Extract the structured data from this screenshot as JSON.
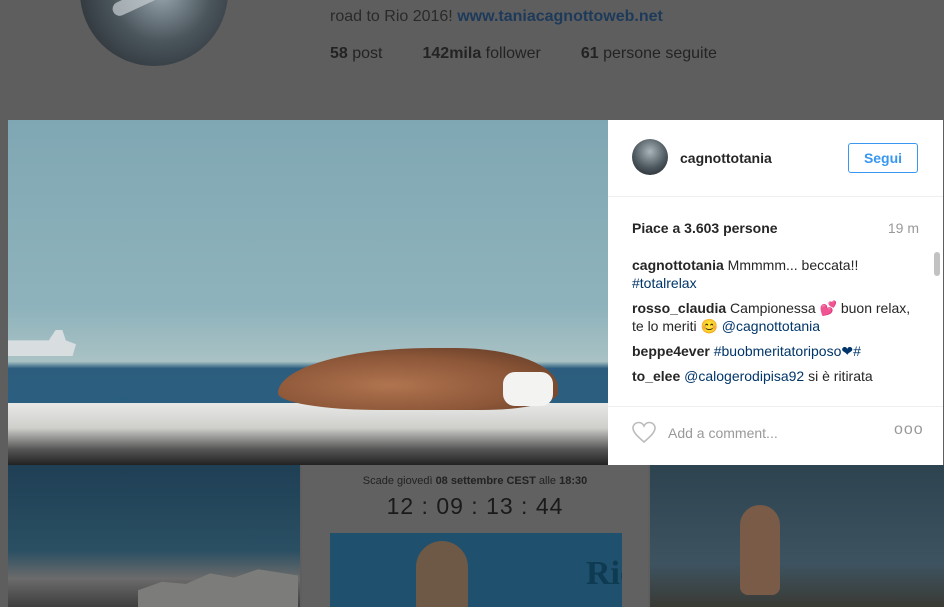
{
  "profile": {
    "bio_line": "road to Rio 2016! ",
    "website": "www.taniacagnottoweb.net",
    "posts_count": "58",
    "posts_label": "post",
    "followers_count": "142mila",
    "followers_label": "follower",
    "following_count": "61",
    "following_label": "persone seguite"
  },
  "post": {
    "username": "cagnottotania",
    "follow_label": "Segui",
    "likes": "Piace a 3.603 persone",
    "time": "19 m",
    "comments": [
      {
        "user": "cagnottotania",
        "text": "Mmmmm... beccata!!",
        "tag": "#totalrelax"
      },
      {
        "user": "rosso_claudia",
        "text": "Campionessa 💕 buon relax, te lo meriti 😊",
        "tag": "@cagnottotania"
      },
      {
        "user": "beppe4ever",
        "text": "",
        "tag": "#buobmeritatoriposo❤#"
      },
      {
        "user": "to_elee",
        "tag": "@calogerodipisa92",
        "text": "si è ritirata"
      }
    ],
    "add_comment_placeholder": "Add a comment...",
    "more_label": "ooo"
  },
  "grid": {
    "countdown_prefix": "Scade giovedì ",
    "countdown_date": "08 settembre CEST",
    "countdown_mid": " alle ",
    "countdown_time": "18:30",
    "countdown_value": "12 : 09 : 13 : 44",
    "rio_text": "Rio"
  },
  "colors": {
    "accent": "#3897f0",
    "overlay": "#5e5e5e"
  },
  "icons": {
    "like": "heart-icon",
    "options": "more-options-icon"
  }
}
